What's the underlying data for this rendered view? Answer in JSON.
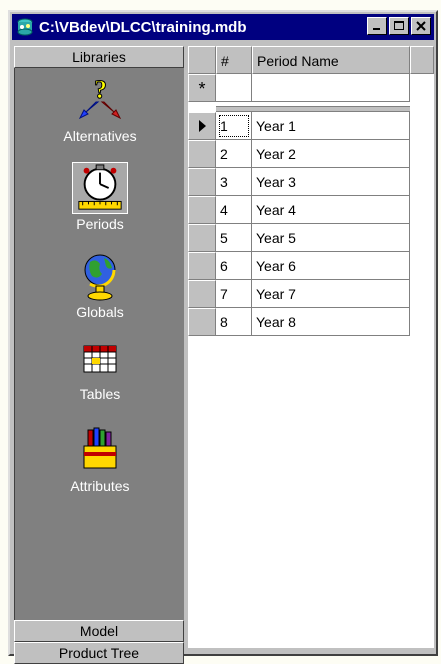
{
  "window": {
    "title": "C:\\VBdev\\DLCC\\training.mdb"
  },
  "sidebar": {
    "header": "Libraries",
    "items": [
      {
        "label": "Alternatives",
        "icon": "alternatives-icon"
      },
      {
        "label": "Periods",
        "icon": "stopwatch-icon",
        "selected": true
      },
      {
        "label": "Globals",
        "icon": "globe-icon"
      },
      {
        "label": "Tables",
        "icon": "table-grid-icon"
      },
      {
        "label": "Attributes",
        "icon": "paint-box-icon"
      }
    ],
    "footer": [
      {
        "label": "Model"
      },
      {
        "label": "Product Tree"
      }
    ]
  },
  "grid": {
    "columns": [
      {
        "label": "#"
      },
      {
        "label": "Period Name"
      }
    ],
    "new_row_marker": "*",
    "rows": [
      {
        "num": "1",
        "name": "Year 1"
      },
      {
        "num": "2",
        "name": "Year 2"
      },
      {
        "num": "3",
        "name": "Year 3"
      },
      {
        "num": "4",
        "name": "Year 4"
      },
      {
        "num": "5",
        "name": "Year 5"
      },
      {
        "num": "6",
        "name": "Year 6"
      },
      {
        "num": "7",
        "name": "Year 7"
      },
      {
        "num": "8",
        "name": "Year 8"
      }
    ]
  }
}
